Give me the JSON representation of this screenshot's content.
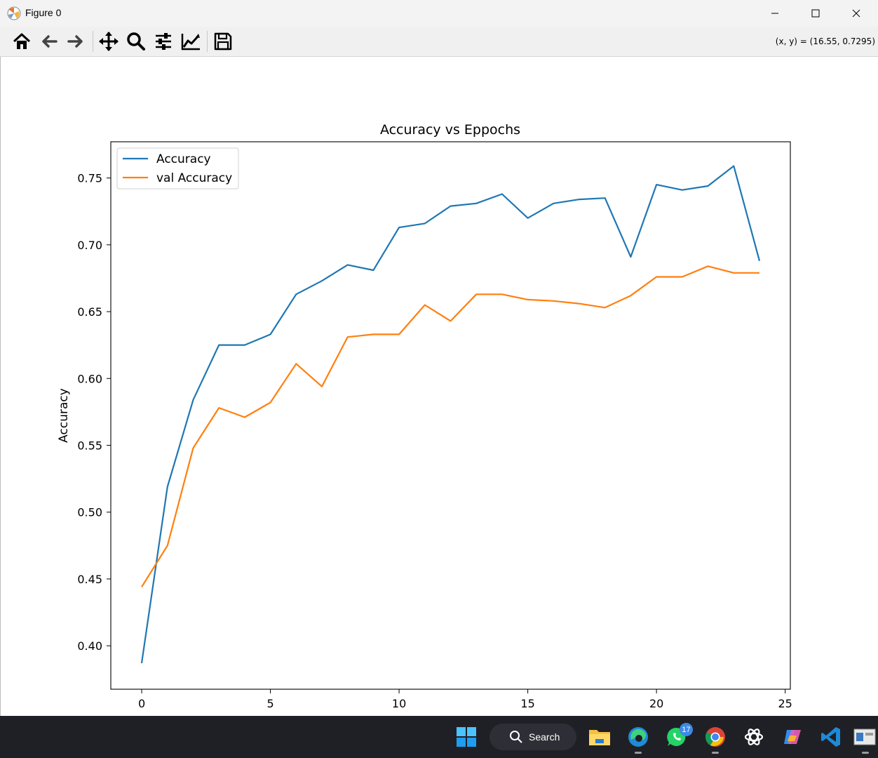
{
  "window": {
    "title": "Figure 0"
  },
  "toolbar": {
    "buttons": [
      "home-icon",
      "back-arrow-icon",
      "forward-arrow-icon",
      "pan-icon",
      "zoom-icon",
      "configure-subplots-icon",
      "edit-axis-icon",
      "save-icon"
    ],
    "coords": "(x, y) = (16.55, 0.7295)"
  },
  "taskbar": {
    "search_label": "Search",
    "whatsapp_badge": "17"
  },
  "colors": {
    "accuracy": "#1f77b4",
    "val_accuracy": "#ff7f0e",
    "taskbar": "#1f2026"
  },
  "chart_data": {
    "type": "line",
    "title": "Accuracy vs Eppochs",
    "xlabel": "",
    "ylabel": "Accuracy",
    "xlim": [
      -1.2,
      25.2
    ],
    "ylim": [
      0.3675,
      0.7771
    ],
    "xticks": [
      0,
      5,
      10,
      15,
      20,
      25
    ],
    "yticks": [
      0.4,
      0.45,
      0.5,
      0.55,
      0.6,
      0.65,
      0.7,
      0.75
    ],
    "ytick_labels": [
      "0.40",
      "0.45",
      "0.50",
      "0.55",
      "0.60",
      "0.65",
      "0.70",
      "0.75"
    ],
    "grid": false,
    "legend_position": "upper-left",
    "x": [
      0,
      1,
      2,
      3,
      4,
      5,
      6,
      7,
      8,
      9,
      10,
      11,
      12,
      13,
      14,
      15,
      16,
      17,
      18,
      19,
      20,
      21,
      22,
      23,
      24
    ],
    "series": [
      {
        "name": "Accuracy",
        "color": "#1f77b4",
        "values": [
          0.387,
          0.519,
          0.584,
          0.625,
          0.625,
          0.633,
          0.663,
          0.673,
          0.685,
          0.681,
          0.713,
          0.716,
          0.729,
          0.731,
          0.738,
          0.72,
          0.731,
          0.734,
          0.735,
          0.691,
          0.745,
          0.741,
          0.744,
          0.759,
          0.688
        ]
      },
      {
        "name": "val Accuracy",
        "color": "#ff7f0e",
        "values": [
          0.444,
          0.475,
          0.548,
          0.578,
          0.571,
          0.582,
          0.611,
          0.594,
          0.631,
          0.633,
          0.633,
          0.655,
          0.643,
          0.663,
          0.663,
          0.659,
          0.658,
          0.656,
          0.653,
          0.662,
          0.676,
          0.676,
          0.684,
          0.679,
          0.679
        ]
      }
    ]
  }
}
